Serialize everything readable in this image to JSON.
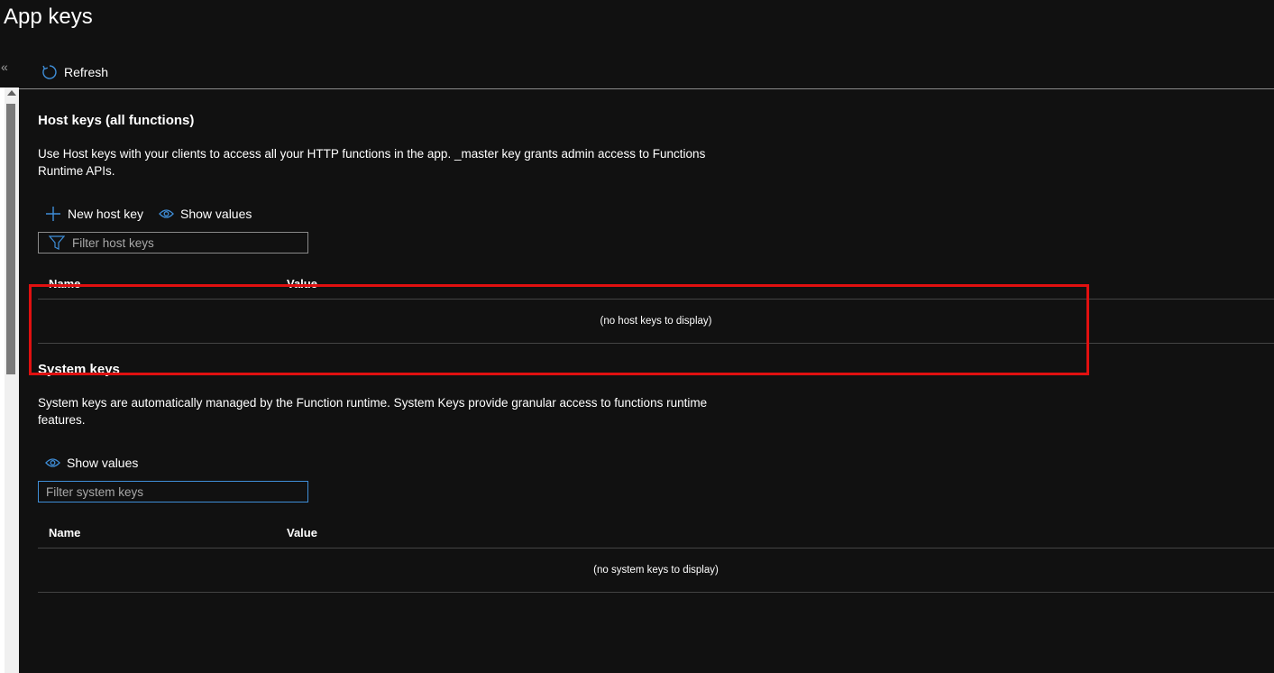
{
  "page": {
    "title": "App keys"
  },
  "nav": {
    "collapse_glyph": "«"
  },
  "toolbar": {
    "refresh_label": "Refresh"
  },
  "host_keys": {
    "title": "Host keys (all functions)",
    "description": "Use Host keys with your clients to access all your HTTP functions in the app. _master key grants admin access to Functions Runtime APIs.",
    "new_key_label": "New host key",
    "show_values_label": "Show values",
    "filter_placeholder": "Filter host keys",
    "columns": {
      "name": "Name",
      "value": "Value"
    },
    "empty_message": "(no host keys to display)"
  },
  "system_keys": {
    "title": "System keys",
    "description": "System keys are automatically managed by the Function runtime. System Keys provide granular access to functions runtime features.",
    "show_values_label": "Show values",
    "filter_placeholder": "Filter system keys",
    "columns": {
      "name": "Name",
      "value": "Value"
    },
    "empty_message": "(no system keys to display)"
  },
  "colors": {
    "background": "#111111",
    "accent": "#3f8ed8",
    "highlight": "#e01010"
  }
}
